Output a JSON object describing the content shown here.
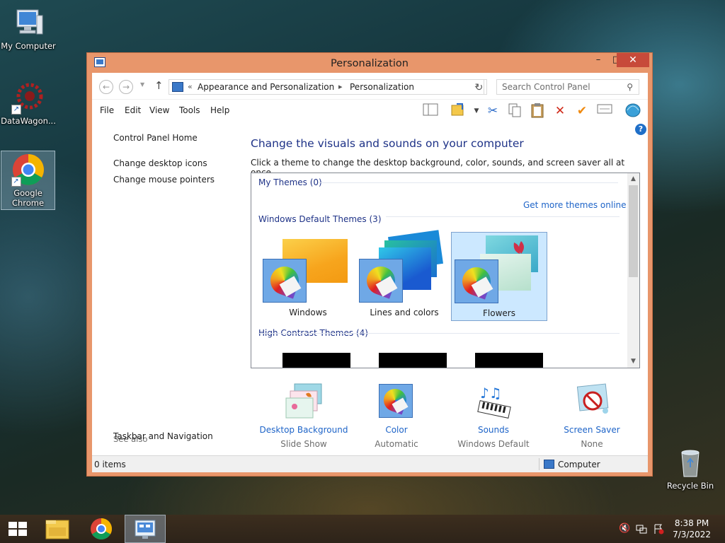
{
  "desktop": {
    "icons": [
      {
        "label": "My Computer"
      },
      {
        "label": "DataWagon..."
      },
      {
        "label": "Google Chrome"
      },
      {
        "label": "Recycle Bin"
      }
    ]
  },
  "window": {
    "title": "Personalization",
    "controls": {
      "minimize": "–",
      "maximize": "□",
      "close": "✕"
    }
  },
  "address": {
    "chevron": "«",
    "crumbs": [
      "Appearance and Personalization",
      "Personalization"
    ],
    "separator": "▸",
    "search_placeholder": "Search Control Panel"
  },
  "menu": {
    "items": [
      "File",
      "Edit",
      "View",
      "Tools",
      "Help"
    ]
  },
  "left_pane": {
    "home": "Control Panel Home",
    "links": [
      "Change desktop icons",
      "Change mouse pointers"
    ],
    "see_also_heading": "See also",
    "see_also_links": [
      "Taskbar and Navigation"
    ]
  },
  "main": {
    "title": "Change the visuals and sounds on your computer",
    "description": "Click a theme to change the desktop background, color, sounds, and screen saver all at once.",
    "groups": {
      "my_themes": "My Themes (0)",
      "get_more": "Get more themes online",
      "default_themes": "Windows Default Themes (3)",
      "high_contrast": "High Contrast Themes (4)"
    },
    "themes": [
      {
        "name": "Windows",
        "selected": false
      },
      {
        "name": "Lines and colors",
        "selected": false
      },
      {
        "name": "Flowers",
        "selected": true
      }
    ]
  },
  "actions": [
    {
      "label": "Desktop Background",
      "value": "Slide Show",
      "icon": "desktop-background-icon"
    },
    {
      "label": "Color",
      "value": "Automatic",
      "icon": "color-icon"
    },
    {
      "label": "Sounds",
      "value": "Windows Default",
      "icon": "sounds-icon"
    },
    {
      "label": "Screen Saver",
      "value": "None",
      "icon": "screen-saver-icon"
    }
  ],
  "status": {
    "items": "0 items",
    "location": "Computer"
  },
  "taskbar": {
    "time": "8:38 PM",
    "date": "7/3/2022"
  },
  "colors": {
    "window_frame": "#e8966b",
    "link": "#1e64c8",
    "heading": "#1e3287",
    "selection": "#cce8ff"
  }
}
